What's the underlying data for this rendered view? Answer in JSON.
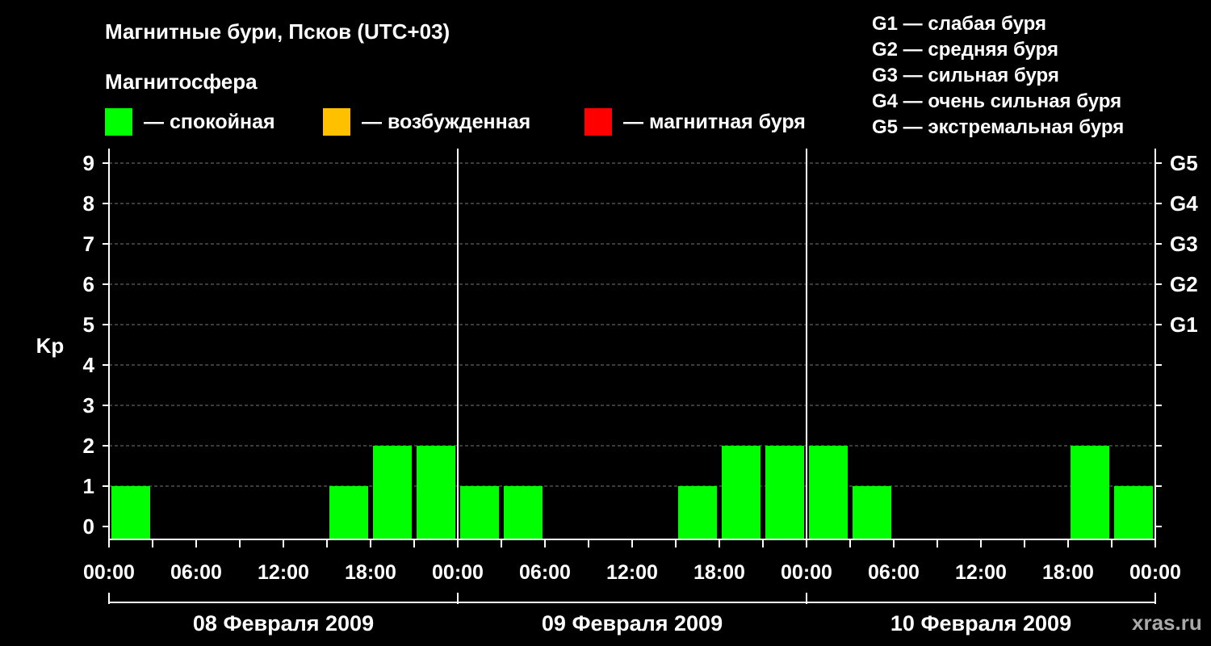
{
  "title": "Магнитные бури, Псков (UTC+03)",
  "subtitle": "Магнитосфера",
  "legend": [
    {
      "label": "— спокойная",
      "color": "#00ff00"
    },
    {
      "label": "— возбужденная",
      "color": "#ffc000"
    },
    {
      "label": "— магнитная буря",
      "color": "#ff0000"
    }
  ],
  "g_levels": [
    "G1 — слабая буря",
    "G2 — средняя буря",
    "G3 — сильная буря",
    "G4 — очень сильная буря",
    "G5 — экстремальная буря"
  ],
  "watermark": "xras.ru",
  "chart_data": {
    "type": "bar",
    "ylabel": "Kp",
    "ylim": [
      0,
      9
    ],
    "yticks": [
      "0",
      "1",
      "2",
      "3",
      "4",
      "5",
      "6",
      "7",
      "8",
      "9"
    ],
    "right_axis_labels": [
      {
        "kp": 5,
        "label": "G1"
      },
      {
        "kp": 6,
        "label": "G2"
      },
      {
        "kp": 7,
        "label": "G3"
      },
      {
        "kp": 8,
        "label": "G4"
      },
      {
        "kp": 9,
        "label": "G5"
      }
    ],
    "xtick_labels": [
      "00:00",
      "06:00",
      "12:00",
      "18:00",
      "00:00",
      "06:00",
      "12:00",
      "18:00",
      "00:00",
      "06:00",
      "12:00",
      "18:00",
      "00:00"
    ],
    "days": [
      "08 Февраля 2009",
      "09 Февраля 2009",
      "10 Февраля 2009"
    ],
    "interval_hours": 3,
    "series": [
      {
        "values": [
          1,
          0,
          0,
          0,
          0,
          1,
          2,
          2,
          1,
          1,
          0,
          0,
          0,
          1,
          2,
          2,
          2,
          1,
          0,
          0,
          0,
          0,
          2,
          1
        ]
      }
    ],
    "bar_color": "#00ff00",
    "grid": true
  }
}
